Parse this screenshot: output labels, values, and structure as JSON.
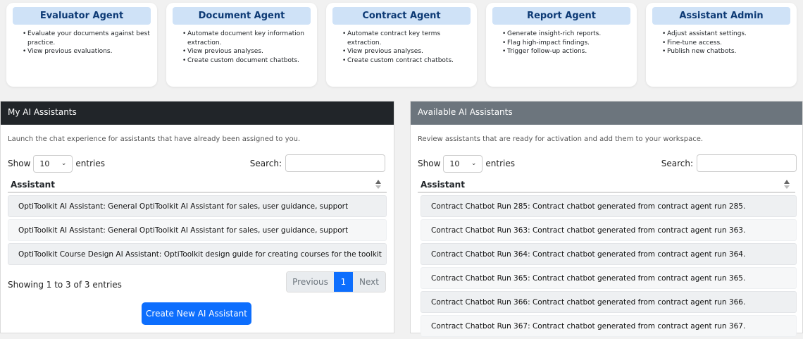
{
  "cards": [
    {
      "title": "Evaluator Agent",
      "items": [
        "Evaluate your documents against best practice.",
        "View previous evaluations."
      ]
    },
    {
      "title": "Document Agent",
      "items": [
        "Automate document key information extraction.",
        "View previous analyses.",
        "Create custom document chatbots."
      ]
    },
    {
      "title": "Contract Agent",
      "items": [
        "Automate contract key terms extraction.",
        "View previous analyses.",
        "Create custom contract chatbots."
      ]
    },
    {
      "title": "Report Agent",
      "items": [
        "Generate insight-rich reports.",
        "Flag high-impact findings.",
        "Trigger follow-up actions."
      ]
    },
    {
      "title": "Assistant Admin",
      "items": [
        "Adjust assistant settings.",
        "Fine-tune access.",
        "Publish new chatbots."
      ]
    }
  ],
  "my_assistants": {
    "header": "My AI Assistants",
    "description": "Launch the chat experience for assistants that have already been assigned to you.",
    "show_label": "Show",
    "entries_value": "10",
    "entries_label": "entries",
    "search_label": "Search:",
    "column_header": "Assistant",
    "rows": [
      "OptiToolkit AI Assistant: General OptiToolkit AI Assistant for sales, user guidance, support",
      "OptiToolkit AI Assistant: General OptiToolkit AI Assistant for sales, user guidance, support",
      "OptiToolkit Course Design AI Assistant: OptiToolkit design guide for creating courses for the toolkit"
    ],
    "info": "Showing 1 to 3 of 3 entries",
    "pager": {
      "previous": "Previous",
      "page": "1",
      "next": "Next"
    },
    "create_button": "Create New AI Assistant"
  },
  "available_assistants": {
    "header": "Available AI Assistants",
    "description": "Review assistants that are ready for activation and add them to your workspace.",
    "show_label": "Show",
    "entries_value": "10",
    "entries_label": "entries",
    "search_label": "Search:",
    "column_header": "Assistant",
    "rows": [
      "Contract Chatbot Run 285: Contract chatbot generated from contract agent run 285.",
      "Contract Chatbot Run 363: Contract chatbot generated from contract agent run 363.",
      "Contract Chatbot Run 364: Contract chatbot generated from contract agent run 364.",
      "Contract Chatbot Run 365: Contract chatbot generated from contract agent run 365.",
      "Contract Chatbot Run 366: Contract chatbot generated from contract agent run 366.",
      "Contract Chatbot Run 367: Contract chatbot generated from contract agent run 367."
    ]
  }
}
